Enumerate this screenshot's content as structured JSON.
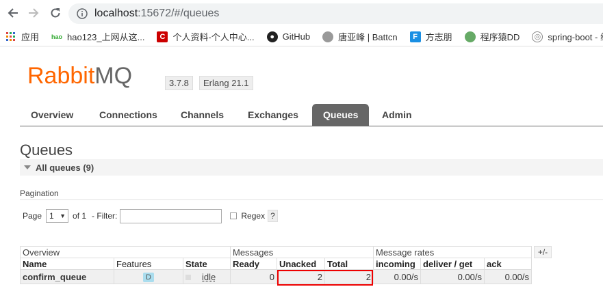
{
  "browser": {
    "url_host": "localhost",
    "url_rest": ":15672/#/queues",
    "bookmarks": [
      {
        "label": "应用",
        "icon": "apps-grid-icon"
      },
      {
        "label": "hao123_上网从这...",
        "icon": "hao123-icon"
      },
      {
        "label": "个人资料-个人中心...",
        "icon": "csdn-icon"
      },
      {
        "label": "GitHub",
        "icon": "github-icon"
      },
      {
        "label": "唐亚峰 | Battcn",
        "icon": "avatar-icon"
      },
      {
        "label": "方志朋",
        "icon": "f-icon"
      },
      {
        "label": "程序猿DD",
        "icon": "avatar-icon"
      },
      {
        "label": "spring-boot - 纯...",
        "icon": "globe-icon"
      }
    ]
  },
  "header": {
    "logo_rabbit": "Rabbit",
    "logo_mq": "MQ",
    "version": "3.7.8",
    "erlang": "Erlang 21.1"
  },
  "tabs": [
    "Overview",
    "Connections",
    "Channels",
    "Exchanges",
    "Queues",
    "Admin"
  ],
  "active_tab": "Queues",
  "page": {
    "title": "Queues",
    "section": "All queues (9)",
    "pagination_label": "Pagination",
    "page_label": "Page",
    "page_value": "1",
    "of_label": "of 1",
    "filter_label": "- Filter:",
    "regex_label": "Regex",
    "help": "?"
  },
  "table": {
    "groups": [
      "Overview",
      "Messages",
      "Message rates"
    ],
    "toggle": "+/-",
    "columns": [
      "Name",
      "Features",
      "State",
      "Ready",
      "Unacked",
      "Total",
      "incoming",
      "deliver / get",
      "ack"
    ],
    "rows": [
      {
        "name": "confirm_queue",
        "feature": "D",
        "state": "idle",
        "ready": "0",
        "unacked": "2",
        "total": "2",
        "incoming": "0.00/s",
        "deliver_get": "0.00/s",
        "ack": "0.00/s"
      }
    ]
  },
  "colors": {
    "accent": "#ff6600",
    "highlight": "#ee0000"
  }
}
